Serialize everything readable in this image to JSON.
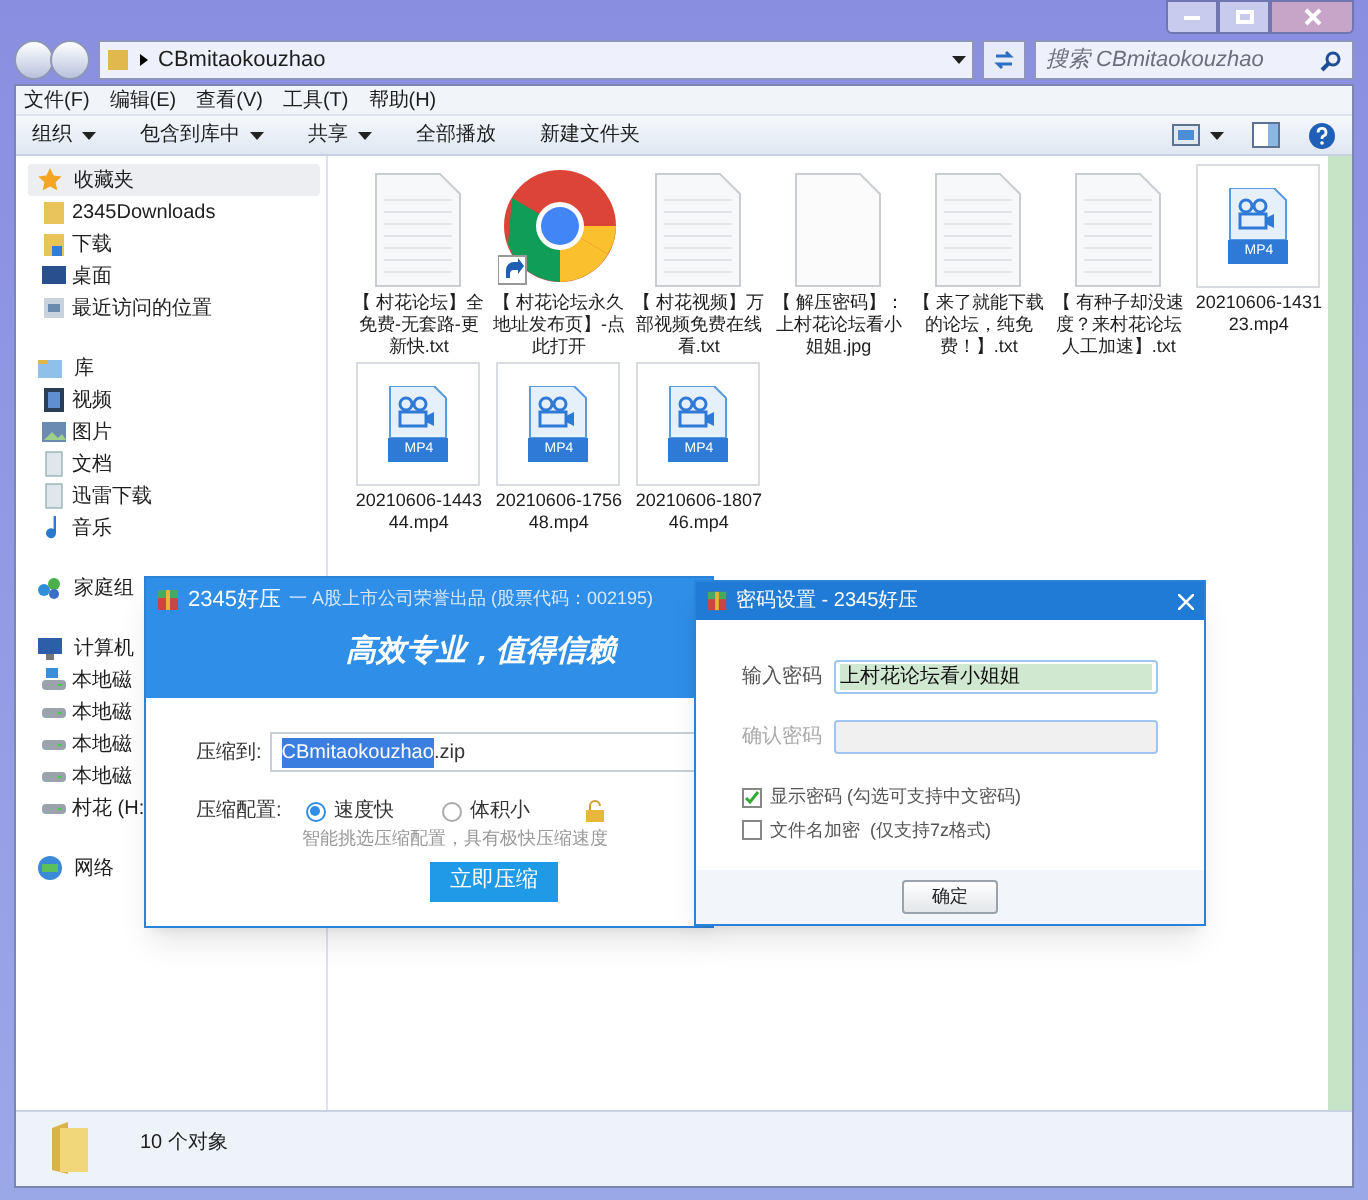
{
  "address_bar": {
    "path": "CBmitaokouzhao",
    "search_placeholder": "搜索 CBmitaokouzhao"
  },
  "menu_bar": [
    "文件(F)",
    "编辑(E)",
    "查看(V)",
    "工具(T)",
    "帮助(H)"
  ],
  "toolbar": [
    {
      "label": "组织",
      "dropdown": true
    },
    {
      "label": "包含到库中",
      "dropdown": true
    },
    {
      "label": "共享",
      "dropdown": true
    },
    {
      "label": "全部播放",
      "dropdown": false
    },
    {
      "label": "新建文件夹",
      "dropdown": false
    }
  ],
  "sidebar": [
    {
      "label": "收藏夹",
      "kind": "star",
      "selected": true,
      "children": [
        {
          "label": "2345Downloads",
          "kind": "folder"
        },
        {
          "label": "下载",
          "kind": "download"
        },
        {
          "label": "桌面",
          "kind": "desktop"
        },
        {
          "label": "最近访问的位置",
          "kind": "recent"
        }
      ]
    },
    {
      "label": "库",
      "kind": "library",
      "selected": false,
      "children": [
        {
          "label": "视频",
          "kind": "video"
        },
        {
          "label": "图片",
          "kind": "image"
        },
        {
          "label": "文档",
          "kind": "doc"
        },
        {
          "label": "迅雷下载",
          "kind": "doc"
        },
        {
          "label": "音乐",
          "kind": "music"
        }
      ]
    },
    {
      "label": "家庭组",
      "kind": "homegroup",
      "selected": false
    },
    {
      "label": "计算机",
      "kind": "computer",
      "selected": false,
      "children": [
        {
          "label": "本地磁",
          "kind": "systemdrive"
        },
        {
          "label": "本地磁",
          "kind": "drive"
        },
        {
          "label": "本地磁",
          "kind": "drive"
        },
        {
          "label": "本地磁",
          "kind": "drive"
        },
        {
          "label": "村花 (H:",
          "kind": "drive"
        }
      ]
    },
    {
      "label": "网络",
      "kind": "network",
      "selected": false
    }
  ],
  "files": [
    {
      "name": "【 村花论坛】全免费-无套路-更新快.txt",
      "kind": "txt"
    },
    {
      "name": "【 村花论坛永久地址发布页】-点此打开",
      "kind": "shortcut"
    },
    {
      "name": "【 村花视频】万部视频免费在线看.txt",
      "kind": "txt"
    },
    {
      "name": "【 解压密码】：上村花论坛看小姐姐.jpg",
      "kind": "jpg"
    },
    {
      "name": "【 来了就能下载的论坛，纯免费！】.txt",
      "kind": "txt"
    },
    {
      "name": "【 有种子却没速度？来村花论坛人工加速】.txt",
      "kind": "txt"
    },
    {
      "name": "20210606-143123.mp4",
      "kind": "mp4",
      "badge": "MP4"
    },
    {
      "name": "20210606-144344.mp4",
      "kind": "mp4",
      "badge": "MP4"
    },
    {
      "name": "20210606-175648.mp4",
      "kind": "mp4",
      "badge": "MP4"
    },
    {
      "name": "20210606-180746.mp4",
      "kind": "mp4",
      "badge": "MP4"
    }
  ],
  "status_bar": "10 个对象",
  "compress_dialog": {
    "app_name": "2345好压",
    "subtitle": "一 A股上市公司荣誉出品 (股票代码：002195)",
    "slogan": "高效专业，值得信赖",
    "target_label": "压缩到:",
    "target_parts": [
      {
        "text": "CBmitaokouzhao",
        "selected": true
      },
      {
        "text": ".zip",
        "selected": false
      }
    ],
    "config_label": "压缩配置:",
    "options": [
      {
        "label": "速度快",
        "selected": true
      },
      {
        "label": "体积小",
        "selected": false
      }
    ],
    "hint": "智能挑选压缩配置，具有极快压缩速度",
    "button": "立即压缩"
  },
  "password_dialog": {
    "title": "密码设置 - 2345好压",
    "fields": [
      {
        "label": "输入密码",
        "value": "上村花论坛看小姐姐",
        "disabled": false
      },
      {
        "label": "确认密码",
        "disabled": true
      }
    ],
    "options": [
      {
        "label": "显示密码 (勾选可支持中文密码)",
        "checked": true
      },
      {
        "label": "文件名加密  (仅支持7z格式)",
        "checked": false
      }
    ],
    "button": "确定"
  }
}
